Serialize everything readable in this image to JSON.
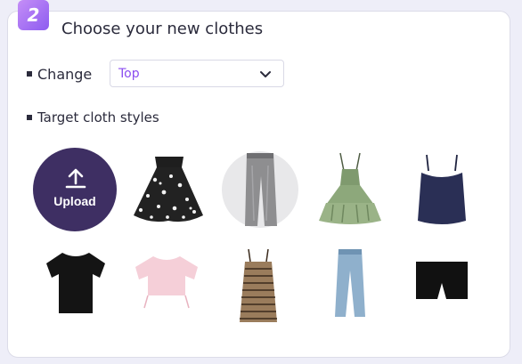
{
  "step": {
    "number": "2"
  },
  "title": "Choose your new clothes",
  "change": {
    "label": "Change",
    "selected": "Top"
  },
  "styles": {
    "label": "Target cloth styles"
  },
  "upload": {
    "label": "Upload"
  },
  "colors": {
    "accent": "#8b4df0",
    "upload_bg": "#3e2f63"
  },
  "cloth_styles": [
    "floral-ruffle-skirt",
    "gray-jeans",
    "green-ruffle-dress",
    "navy-cami-top",
    "black-tshirt",
    "pink-crop-top",
    "striped-bodycon-dress",
    "light-blue-jeans",
    "black-shorts"
  ]
}
